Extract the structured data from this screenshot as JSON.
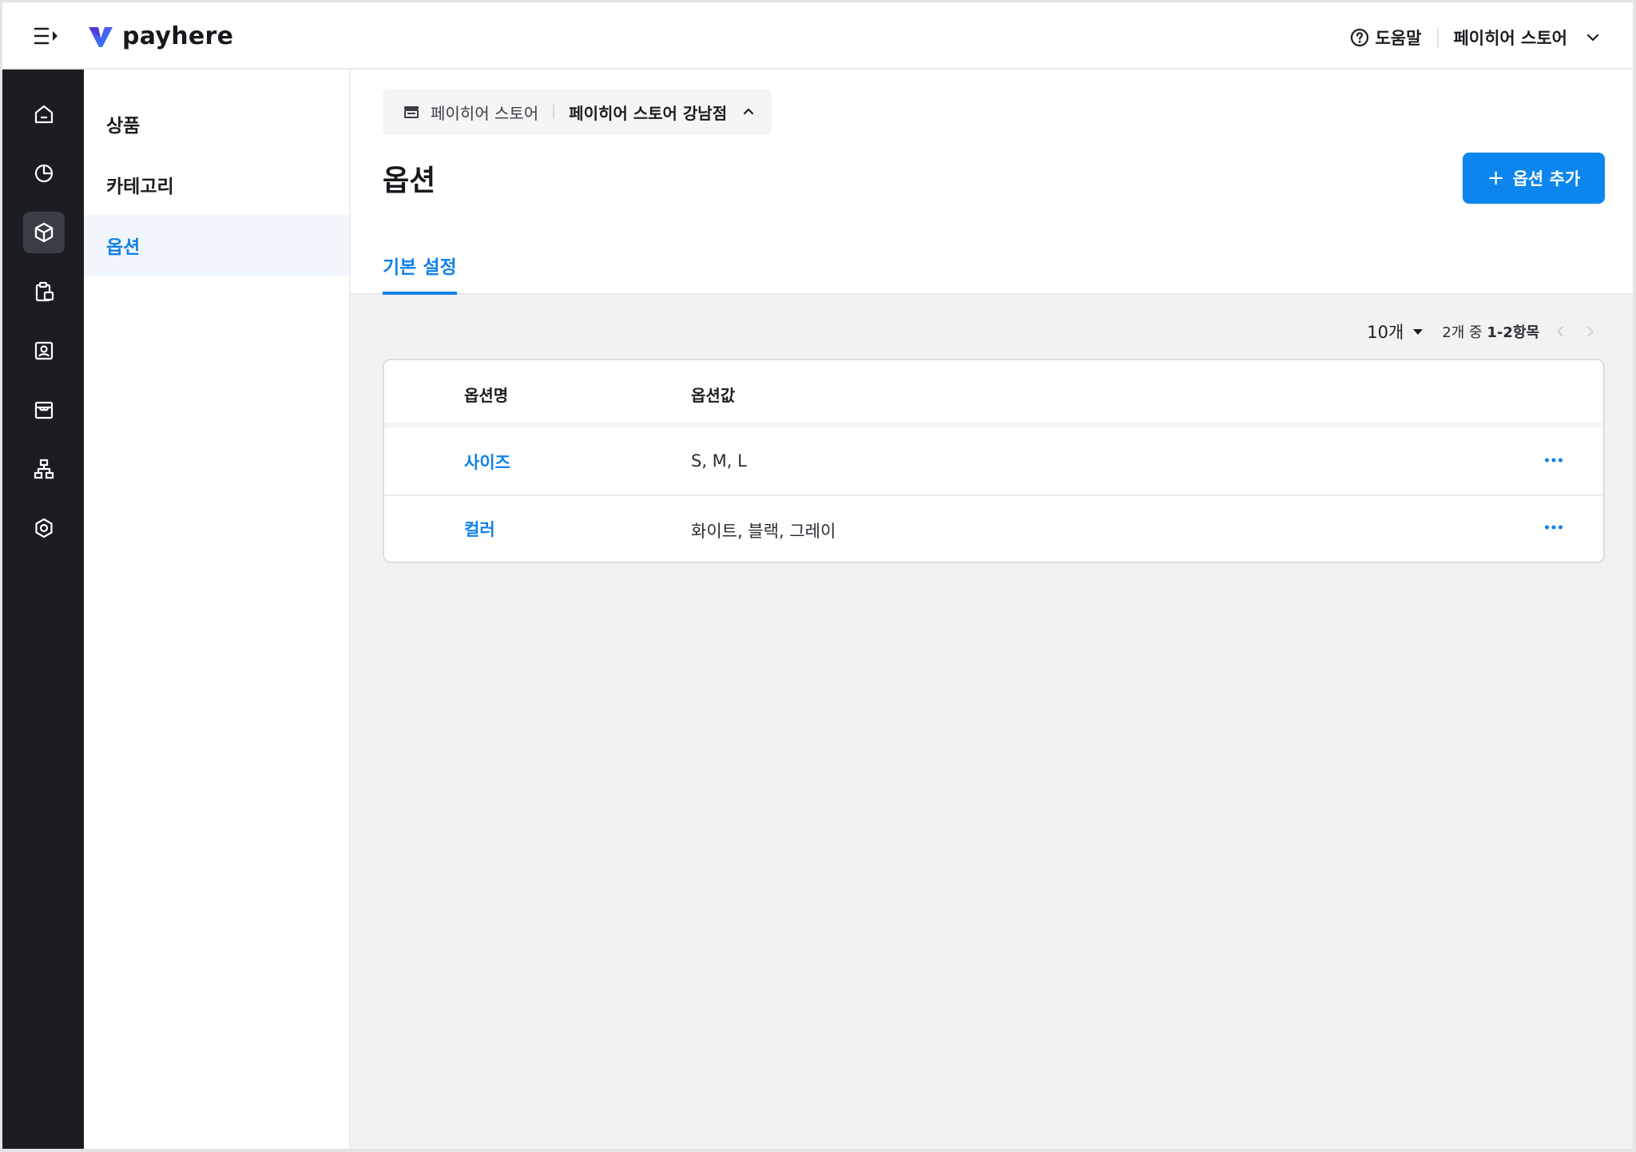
{
  "brand": {
    "name": "payhere",
    "accent": "#1181e8",
    "primary_button": "#0c86ee"
  },
  "topbar": {
    "menu_icon": "menu-collapse-icon",
    "help_label": "도움말",
    "store_label": "페이히어 스토어"
  },
  "rail": {
    "items": [
      {
        "icon": "home-icon"
      },
      {
        "icon": "chart-pie-icon"
      },
      {
        "icon": "box-icon",
        "active": true
      },
      {
        "icon": "clipboard-icon"
      },
      {
        "icon": "contact-icon"
      },
      {
        "icon": "store-icon"
      },
      {
        "icon": "org-chart-icon"
      },
      {
        "icon": "settings-icon"
      }
    ]
  },
  "subnav": {
    "items": [
      {
        "label": "상품"
      },
      {
        "label": "카테고리"
      },
      {
        "label": "옵션",
        "active": true
      }
    ]
  },
  "breadcrumb": {
    "parent": "페이히어 스토어",
    "current": "페이히어 스토어 강남점"
  },
  "page": {
    "title": "옵션",
    "add_button": "옵션 추가",
    "tab": "기본 설정"
  },
  "pager": {
    "page_size": "10개",
    "range_prefix": "2개 중",
    "range": "1-2항목"
  },
  "table": {
    "columns": [
      "옵션명",
      "옵션값"
    ],
    "rows": [
      {
        "name": "사이즈",
        "values": "S, M, L"
      },
      {
        "name": "컬러",
        "values": "화이트, 블랙, 그레이"
      }
    ]
  }
}
